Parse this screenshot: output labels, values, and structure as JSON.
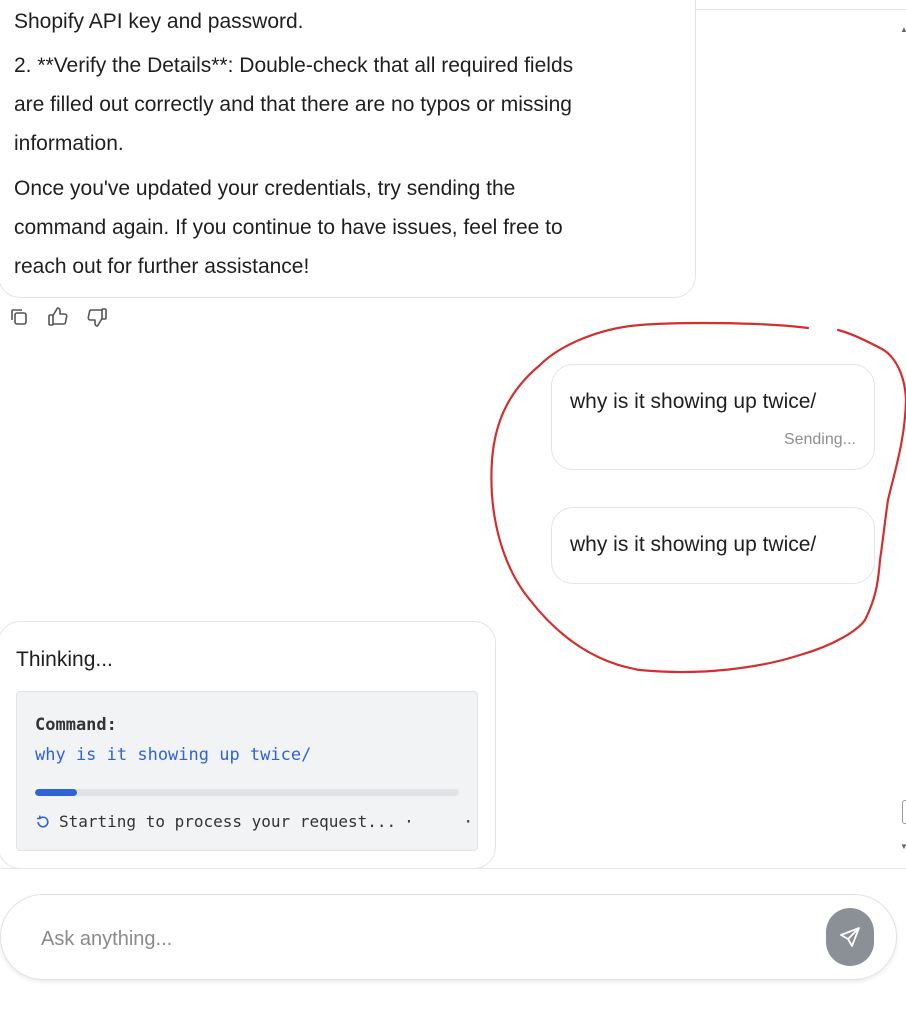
{
  "assistant_message": {
    "lines": [
      "Shopify API key and password.",
      "2. **Verify the Details**: Double-check that all required fields",
      "are filled out correctly and that there are no typos or missing",
      "information.",
      "Once you've updated your credentials, try sending the",
      "command again. If you continue to have issues, feel free to",
      "reach out for further assistance!"
    ],
    "actions": [
      "copy-icon",
      "thumbs-up-icon",
      "thumbs-down-icon"
    ]
  },
  "user_messages": [
    {
      "text": "why is it showing up twice/",
      "status": "Sending..."
    },
    {
      "text": "why is it showing up twice/"
    }
  ],
  "thinking": {
    "title": "Thinking...",
    "command_label": "Command:",
    "command_text": "why is it showing up twice/",
    "progress": 0.1,
    "progress_status": "Starting to process your request...",
    "dots": "· ·",
    "accent_color": "#2f63d6"
  },
  "composer": {
    "placeholder": "Ask anything...",
    "send_icon": "send-icon"
  },
  "annotation_color": "#d32f2f"
}
